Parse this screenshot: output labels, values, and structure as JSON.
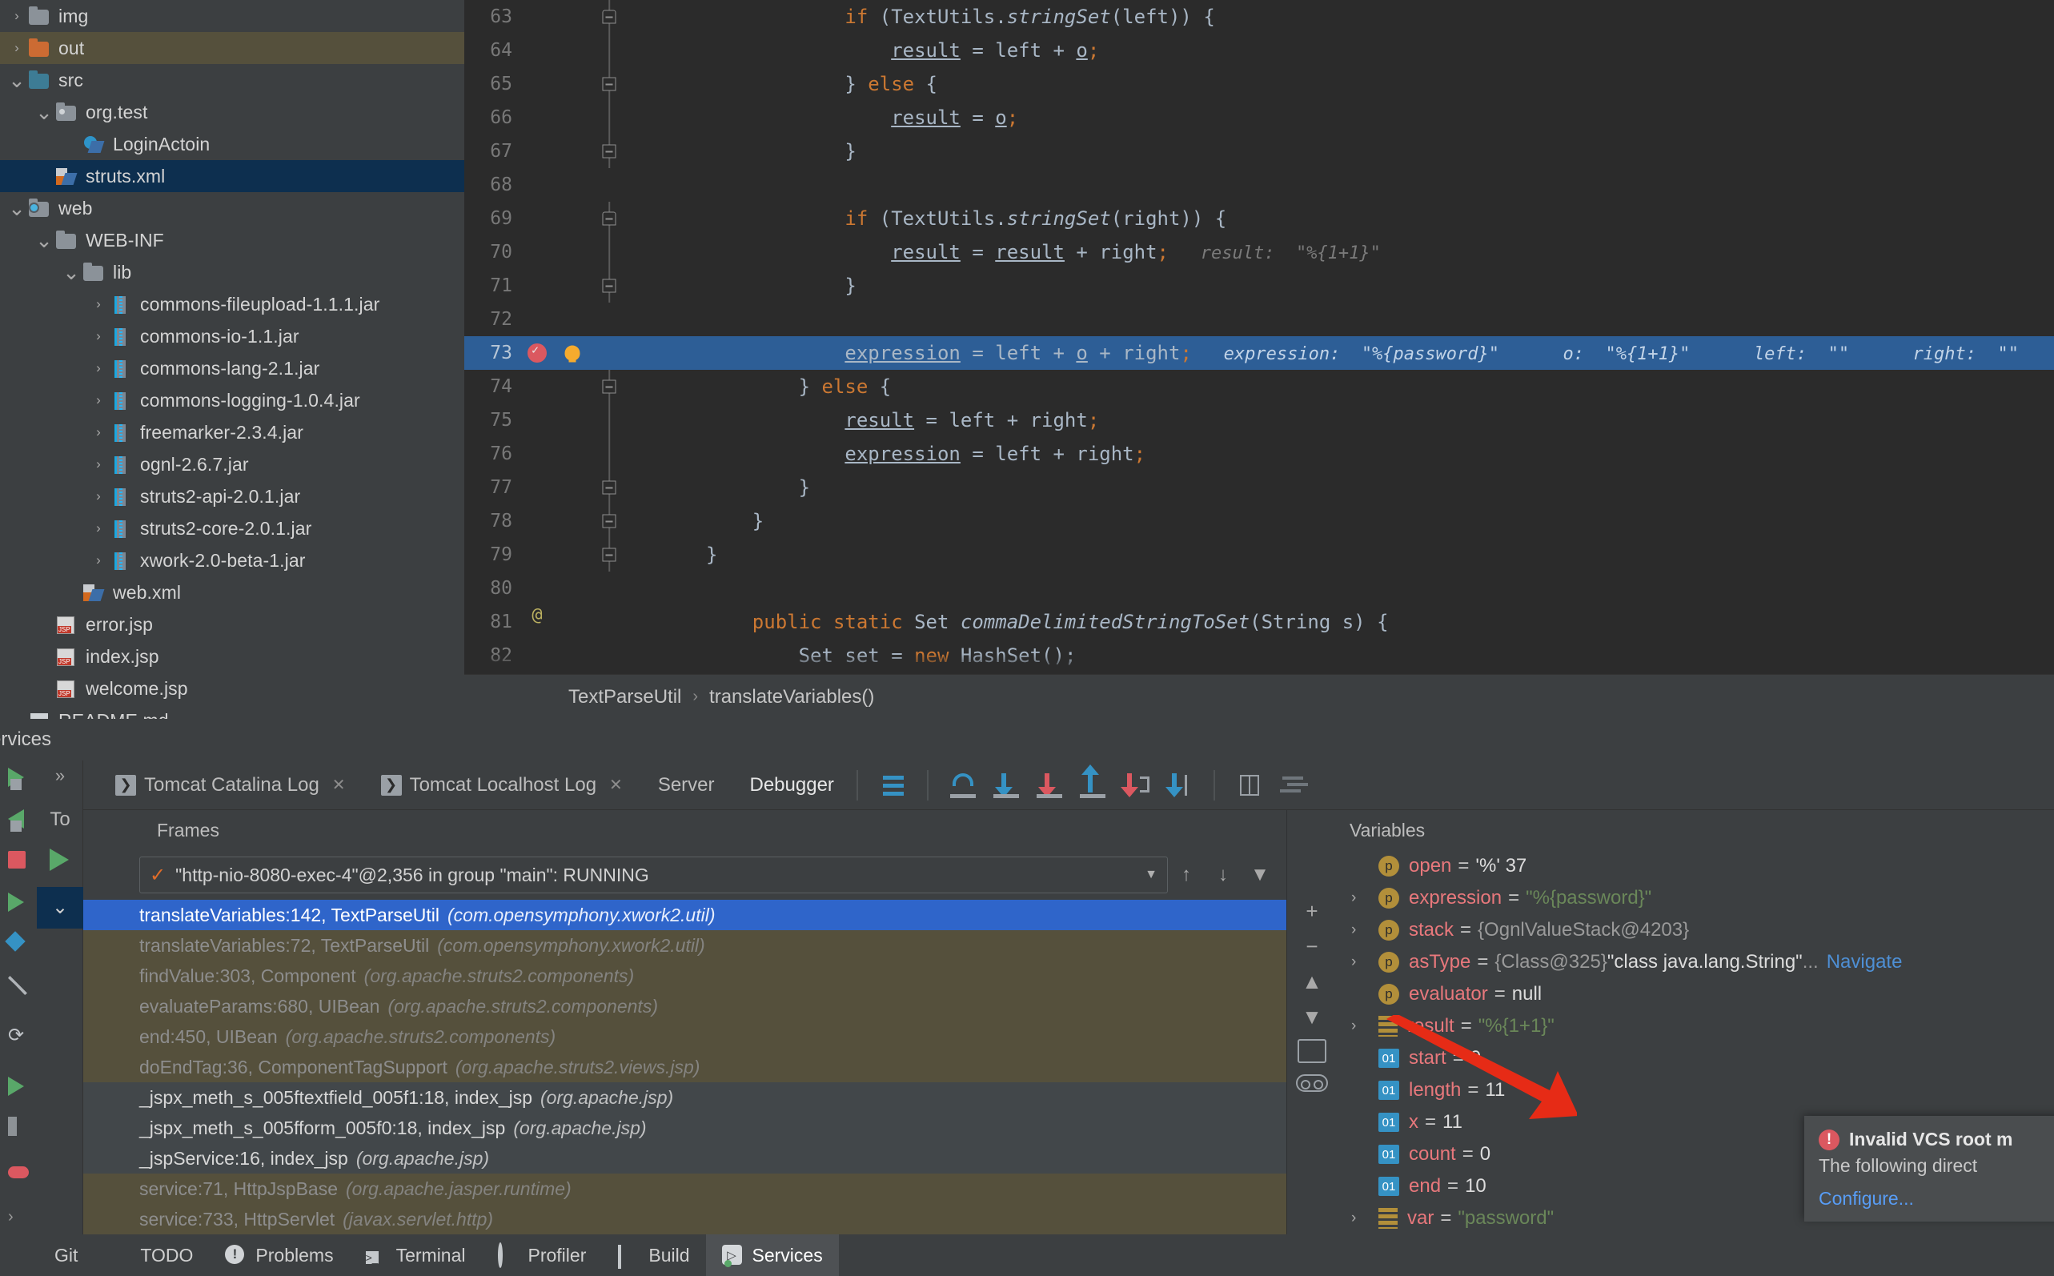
{
  "project_tree": [
    {
      "label": "img",
      "indent": 0,
      "arrow": "right",
      "icon": "folder-grey",
      "state": "partial"
    },
    {
      "label": "out",
      "indent": 0,
      "arrow": "right",
      "icon": "folder-orange",
      "state": "olive"
    },
    {
      "label": "src",
      "indent": 0,
      "arrow": "down",
      "icon": "folder-teal",
      "state": "none"
    },
    {
      "label": "org.test",
      "indent": 1,
      "arrow": "down",
      "icon": "package",
      "state": "none"
    },
    {
      "label": "LoginActoin",
      "indent": 2,
      "arrow": "none",
      "icon": "java-class",
      "state": "none"
    },
    {
      "label": "struts.xml",
      "indent": 1,
      "arrow": "none",
      "icon": "xml-file",
      "state": "blue"
    },
    {
      "label": "web",
      "indent": 0,
      "arrow": "down",
      "icon": "source-root",
      "state": "none"
    },
    {
      "label": "WEB-INF",
      "indent": 1,
      "arrow": "down",
      "icon": "folder-grey",
      "state": "none"
    },
    {
      "label": "lib",
      "indent": 2,
      "arrow": "down",
      "icon": "folder-grey",
      "state": "none"
    },
    {
      "label": "commons-fileupload-1.1.1.jar",
      "indent": 3,
      "arrow": "right",
      "icon": "jar",
      "state": "none"
    },
    {
      "label": "commons-io-1.1.jar",
      "indent": 3,
      "arrow": "right",
      "icon": "jar",
      "state": "none"
    },
    {
      "label": "commons-lang-2.1.jar",
      "indent": 3,
      "arrow": "right",
      "icon": "jar",
      "state": "none"
    },
    {
      "label": "commons-logging-1.0.4.jar",
      "indent": 3,
      "arrow": "right",
      "icon": "jar",
      "state": "none"
    },
    {
      "label": "freemarker-2.3.4.jar",
      "indent": 3,
      "arrow": "right",
      "icon": "jar",
      "state": "none"
    },
    {
      "label": "ognl-2.6.7.jar",
      "indent": 3,
      "arrow": "right",
      "icon": "jar",
      "state": "none"
    },
    {
      "label": "struts2-api-2.0.1.jar",
      "indent": 3,
      "arrow": "right",
      "icon": "jar",
      "state": "none"
    },
    {
      "label": "struts2-core-2.0.1.jar",
      "indent": 3,
      "arrow": "right",
      "icon": "jar",
      "state": "none"
    },
    {
      "label": "xwork-2.0-beta-1.jar",
      "indent": 3,
      "arrow": "right",
      "icon": "jar",
      "state": "none"
    },
    {
      "label": "web.xml",
      "indent": 2,
      "arrow": "none",
      "icon": "xml-file",
      "state": "none"
    },
    {
      "label": "error.jsp",
      "indent": 1,
      "arrow": "none",
      "icon": "jsp",
      "state": "none"
    },
    {
      "label": "index.jsp",
      "indent": 1,
      "arrow": "none",
      "icon": "jsp",
      "state": "none"
    },
    {
      "label": "welcome.jsp",
      "indent": 1,
      "arrow": "none",
      "icon": "jsp",
      "state": "none"
    },
    {
      "label": "README.md",
      "indent": 0,
      "arrow": "none",
      "icon": "markdown",
      "state": "none"
    }
  ],
  "editor": {
    "breadcrumb_class": "TextParseUtil",
    "breadcrumb_method": "translateVariables()",
    "lines": [
      {
        "num": "63",
        "fold": "start",
        "code_html": "            <span class=\"kw\">if</span> (TextUtils.<span class=\"mth\">stringSet</span>(left)) {",
        "hint": ""
      },
      {
        "num": "64",
        "fold": "line",
        "code_html": "                <span class=\"ident-u\">result</span> = left + <span class=\"ident-u\">o</span><span class=\"semi\">;</span>",
        "hint": ""
      },
      {
        "num": "65",
        "fold": "mid",
        "code_html": "            } <span class=\"kw\">else</span> {",
        "hint": ""
      },
      {
        "num": "66",
        "fold": "line",
        "code_html": "                <span class=\"ident-u\">result</span> = <span class=\"ident-u\">o</span><span class=\"semi\">;</span>",
        "hint": ""
      },
      {
        "num": "67",
        "fold": "mid",
        "code_html": "            }",
        "hint": ""
      },
      {
        "num": "68",
        "fold": "none",
        "code_html": "",
        "hint": ""
      },
      {
        "num": "69",
        "fold": "start",
        "code_html": "            <span class=\"kw\">if</span> (TextUtils.<span class=\"mth\">stringSet</span>(right)) {",
        "hint": ""
      },
      {
        "num": "70",
        "fold": "line",
        "code_html": "                <span class=\"ident-u\">result</span> = <span class=\"ident-u\">result</span> + right<span class=\"semi\">;</span>",
        "hint": "result:  \"%{1+1}\""
      },
      {
        "num": "71",
        "fold": "mid",
        "code_html": "            }",
        "hint": ""
      },
      {
        "num": "72",
        "fold": "none",
        "code_html": "",
        "hint": ""
      },
      {
        "num": "73",
        "fold": "none",
        "highlight": true,
        "breakpoint": true,
        "bulb": true,
        "code_html": "            <span class=\"ident-u\">expression</span> = left + <span class=\"ident-u\">o</span> + right<span class=\"semi\">;</span>",
        "hint": "expression:  \"%{password}\"      o:  \"%{1+1}\"      left:  \"\"      right:  \"\""
      },
      {
        "num": "74",
        "fold": "mid",
        "code_html": "        } <span class=\"kw\">else</span> {",
        "hint": ""
      },
      {
        "num": "75",
        "fold": "line",
        "code_html": "            <span class=\"ident-u\">result</span> = left + right<span class=\"semi\">;</span>",
        "hint": ""
      },
      {
        "num": "76",
        "fold": "line",
        "code_html": "            <span class=\"ident-u\">expression</span> = left + right<span class=\"semi\">;</span>",
        "hint": ""
      },
      {
        "num": "77",
        "fold": "mid",
        "code_html": "        }",
        "hint": ""
      },
      {
        "num": "78",
        "fold": "mid",
        "code_html": "    }",
        "hint": ""
      },
      {
        "num": "79",
        "fold": "mid",
        "code_html": "}",
        "hint": ""
      },
      {
        "num": "80",
        "fold": "none",
        "code_html": "",
        "hint": ""
      },
      {
        "num": "81",
        "fold": "none",
        "annotation": "@",
        "code_html": "    <span class=\"kw\">public static</span> Set <span class=\"mth\">commaDelimitedStringToSet</span>(String s) {",
        "hint": ""
      },
      {
        "num": "82",
        "fold": "none",
        "code_html": "        Set set = <span class=\"kw\">new</span> HashSet();",
        "hint": ""
      }
    ]
  },
  "services_label": "ervices",
  "debug_tabs": [
    {
      "label": "Debugger",
      "active": true,
      "badge": null,
      "closable": false
    },
    {
      "label": "Server",
      "active": false,
      "badge": null,
      "closable": false
    },
    {
      "label": "Tomcat Localhost Log",
      "active": false,
      "badge": "❯",
      "closable": true
    },
    {
      "label": "Tomcat Catalina Log",
      "active": false,
      "badge": "❯",
      "closable": true
    }
  ],
  "debug_toolbar_icons": [
    "lines-icon",
    "step-over-icon",
    "step-into-icon",
    "force-step-into-icon",
    "step-out-icon",
    "drop-frame-icon",
    "run-to-cursor-icon",
    "evaluate-expression-icon",
    "mute-breakpoints-icon"
  ],
  "frames": {
    "header": "Frames",
    "thread": "\"http-nio-8080-exec-4\"@2,356 in group \"main\": RUNNING",
    "items": [
      {
        "text": "translateVariables:142, TextParseUtil",
        "pkg": "(com.opensymphony.xwork2.util)",
        "style": "selected"
      },
      {
        "text": "translateVariables:72, TextParseUtil",
        "pkg": "(com.opensymphony.xwork2.util)",
        "style": "lib"
      },
      {
        "text": "findValue:303, Component",
        "pkg": "(org.apache.struts2.components)",
        "style": "lib"
      },
      {
        "text": "evaluateParams:680, UIBean",
        "pkg": "(org.apache.struts2.components)",
        "style": "lib"
      },
      {
        "text": "end:450, UIBean",
        "pkg": "(org.apache.struts2.components)",
        "style": "lib"
      },
      {
        "text": "doEndTag:36, ComponentTagSupport",
        "pkg": "(org.apache.struts2.views.jsp)",
        "style": "lib"
      },
      {
        "text": "_jspx_meth_s_005ftextfield_005f1:18, index_jsp",
        "pkg": "(org.apache.jsp)",
        "style": "usr"
      },
      {
        "text": "_jspx_meth_s_005fform_005f0:18, index_jsp",
        "pkg": "(org.apache.jsp)",
        "style": "usr"
      },
      {
        "text": "_jspService:16, index_jsp",
        "pkg": "(org.apache.jsp)",
        "style": "usr"
      },
      {
        "text": "service:71, HttpJspBase",
        "pkg": "(org.apache.jasper.runtime)",
        "style": "lib"
      },
      {
        "text": "service:733, HttpServlet",
        "pkg": "(javax.servlet.http)",
        "style": "lib"
      }
    ]
  },
  "variables": {
    "header": "Variables",
    "items": [
      {
        "twist": false,
        "badge": "p",
        "name": "open",
        "eq": "=",
        "value": "'%' 37",
        "vclass": "vwhite"
      },
      {
        "twist": true,
        "badge": "p",
        "name": "expression",
        "eq": "=",
        "value": "\"%{password}\"",
        "vclass": "vstr"
      },
      {
        "twist": true,
        "badge": "p",
        "name": "stack",
        "eq": "=",
        "value": "{OgnlValueStack@4203}",
        "vclass": "vgrey"
      },
      {
        "twist": true,
        "badge": "p",
        "name": "asType",
        "eq": "=",
        "value": "{Class@325}",
        "vclass": "vgrey",
        "value2": "\"class java.lang.String\"",
        "v2class": "vwhite",
        "ellipsis": "...",
        "link": "Navigate"
      },
      {
        "twist": false,
        "badge": "p",
        "name": "evaluator",
        "eq": "=",
        "value": "null",
        "vclass": "vwhite"
      },
      {
        "twist": true,
        "badge": "str",
        "name": "result",
        "eq": "=",
        "value": "\"%{1+1}\"",
        "vclass": "vstr"
      },
      {
        "twist": false,
        "badge": "01",
        "name": "start",
        "eq": "=",
        "value": "0",
        "vclass": "vnum"
      },
      {
        "twist": false,
        "badge": "01",
        "name": "length",
        "eq": "=",
        "value": "11",
        "vclass": "vnum"
      },
      {
        "twist": false,
        "badge": "01",
        "name": "x",
        "eq": "=",
        "value": "11",
        "vclass": "vnum"
      },
      {
        "twist": false,
        "badge": "01",
        "name": "count",
        "eq": "=",
        "value": "0",
        "vclass": "vnum"
      },
      {
        "twist": false,
        "badge": "01",
        "name": "end",
        "eq": "=",
        "value": "10",
        "vclass": "vnum"
      },
      {
        "twist": true,
        "badge": "str",
        "name": "var",
        "eq": "=",
        "value": "\"password\"",
        "vclass": "vstr"
      }
    ]
  },
  "vcs_popup": {
    "title": "Invalid VCS root m",
    "body": "The following direct",
    "link": "Configure..."
  },
  "status_bar": [
    {
      "label": "Git",
      "icon": "git-icon",
      "active": false
    },
    {
      "label": "TODO",
      "icon": "todo-icon",
      "active": false
    },
    {
      "label": "Problems",
      "icon": "problems-icon",
      "active": false
    },
    {
      "label": "Terminal",
      "icon": "terminal-icon",
      "active": false
    },
    {
      "label": "Profiler",
      "icon": "profiler-icon",
      "active": false
    },
    {
      "label": "Build",
      "icon": "build-icon",
      "active": false
    },
    {
      "label": "Services",
      "icon": "services-icon",
      "active": true
    }
  ],
  "colors": {
    "accent_blue": "#2f65ca",
    "selection_editor": "#2d5e96",
    "panel_bg": "#3c3f41",
    "editor_bg": "#2b2b2b",
    "olive_row": "#55503c",
    "string_green": "#6a8759",
    "keyword_orange": "#cc7832",
    "var_name_pink": "#e8787c",
    "error_red": "#db5860",
    "arrow_red": "#e03020"
  }
}
